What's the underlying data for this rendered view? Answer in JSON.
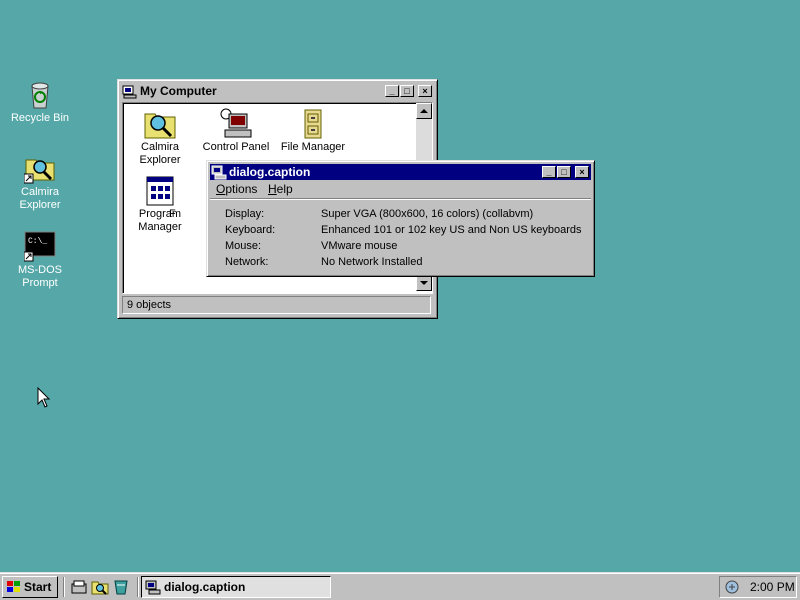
{
  "desktop": {
    "background": "#56a8a8",
    "icons": [
      {
        "label": "Recycle Bin",
        "icon": "recycle-bin-icon"
      },
      {
        "label": "Calmira Explorer",
        "icon": "calmira-explorer-icon"
      },
      {
        "label": "MS-DOS Prompt",
        "icon": "ms-dos-prompt-icon"
      }
    ]
  },
  "my_computer": {
    "title": "My Computer",
    "items": [
      {
        "label": "Calmira Explorer",
        "icon": "magnifier-icon"
      },
      {
        "label": "Control Panel",
        "icon": "control-panel-icon"
      },
      {
        "label": "File Manager",
        "icon": "file-cabinet-icon"
      },
      {
        "label": "Program Manager",
        "icon": "program-manager-icon"
      },
      {
        "label": "F",
        "icon": "partially-hidden-icon"
      }
    ],
    "status": "9 objects",
    "buttons": {
      "minimize": "minimize",
      "maximize": "maximize",
      "close": "close"
    }
  },
  "dialog": {
    "title": "dialog.caption",
    "menu": [
      {
        "label": "Options",
        "accel": "O",
        "rest": "ptions"
      },
      {
        "label": "Help",
        "accel": "H",
        "rest": "elp"
      }
    ],
    "rows": [
      {
        "label": "Display:",
        "value": "Super VGA (800x600, 16 colors) (collabvm)"
      },
      {
        "label": "Keyboard:",
        "value": "Enhanced 101 or 102 key US and Non US keyboards"
      },
      {
        "label": "Mouse:",
        "value": "VMware mouse"
      },
      {
        "label": "Network:",
        "value": "No Network Installed"
      }
    ],
    "title_color": "#000080"
  },
  "taskbar": {
    "start_label": "Start",
    "quick_launch": [
      "quick-launch-icon-1",
      "quick-launch-icon-2",
      "quick-launch-icon-3"
    ],
    "task_button": "dialog.caption",
    "clock": "2:00 PM"
  }
}
